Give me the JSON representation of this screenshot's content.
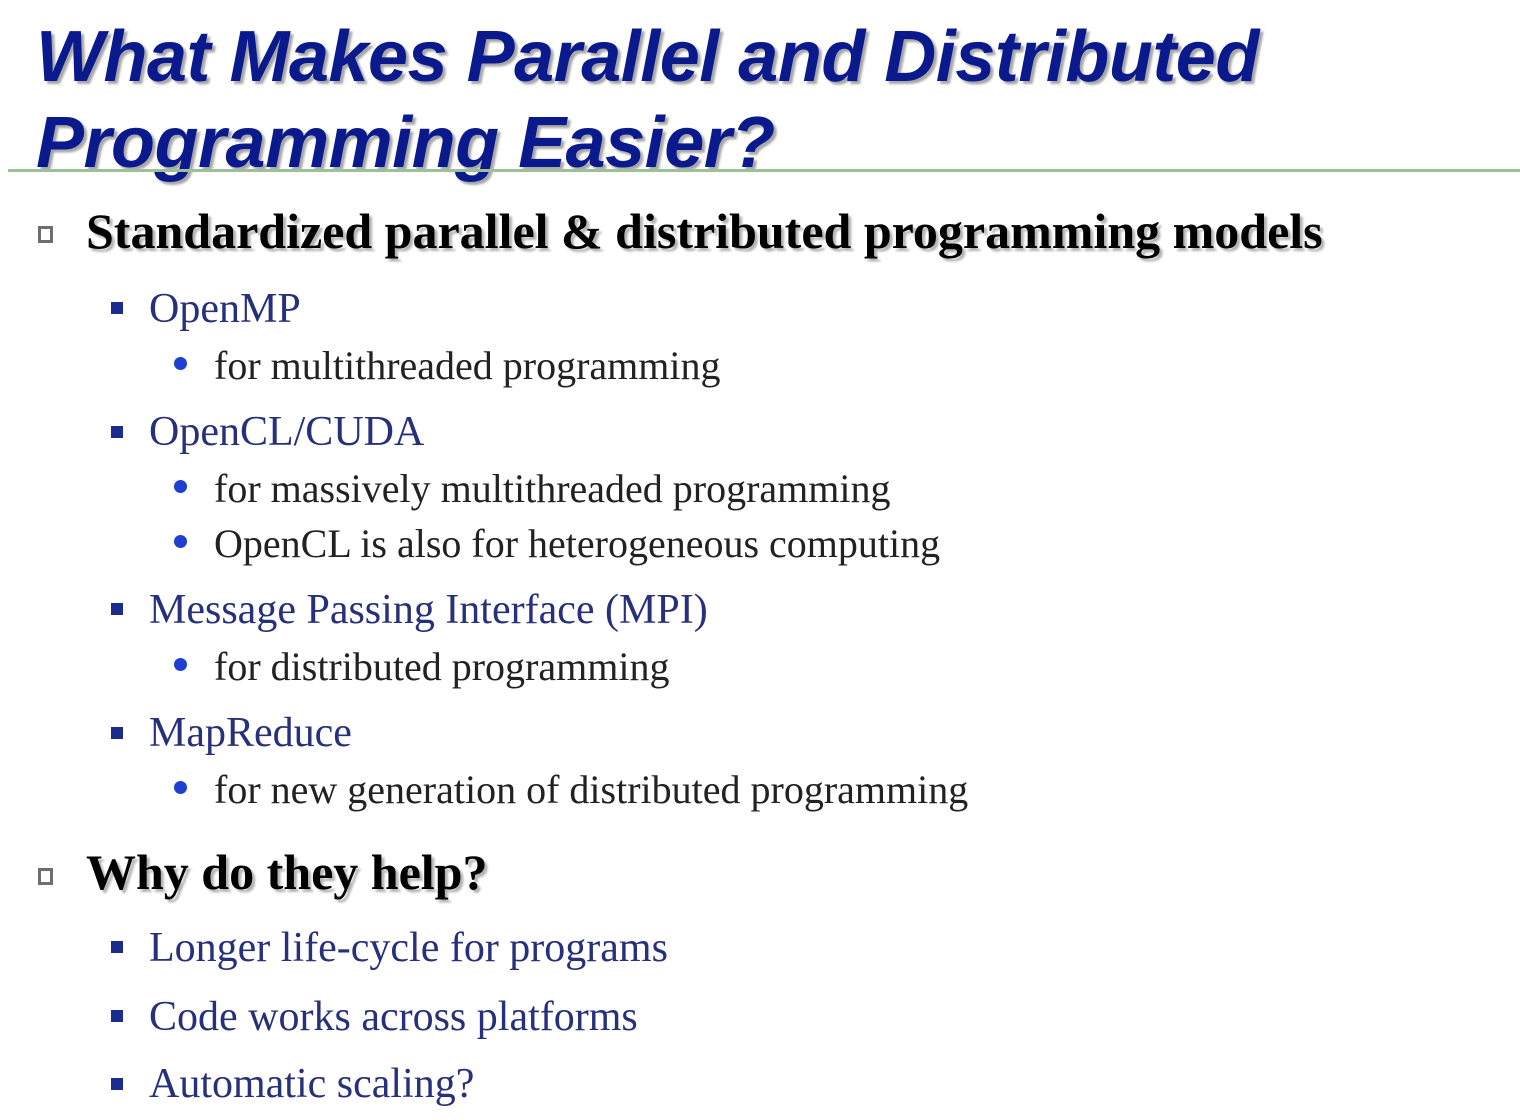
{
  "slide": {
    "title_line1": "What Makes Parallel and Distributed",
    "title_line2": "Programming Easier?",
    "section1": {
      "heading": "Standardized parallel & distributed programming models",
      "items": [
        {
          "label": "OpenMP",
          "subitems": [
            "for multithreaded programming"
          ]
        },
        {
          "label": "OpenCL/CUDA",
          "subitems": [
            "for massively multithreaded programming",
            "OpenCL is also for heterogeneous computing"
          ]
        },
        {
          "label": "Message Passing Interface (MPI)",
          "subitems": [
            "for distributed programming"
          ]
        },
        {
          "label": "MapReduce",
          "subitems": [
            "for new generation of distributed programming"
          ]
        }
      ]
    },
    "section2": {
      "heading": "Why do they help?",
      "items": [
        {
          "label": "Longer life-cycle for programs"
        },
        {
          "label": "Code works across platforms"
        },
        {
          "label": "Automatic scaling?"
        }
      ]
    },
    "colors": {
      "title": "#0a1a8c",
      "rule": "#9cc09a",
      "level2_text": "#27307a",
      "level2_bullet": "#1a2d8f",
      "level3_bullet": "#1f3fd1"
    },
    "bullet_icons": {
      "level1": "hollow-square-icon",
      "level2": "filled-square-icon",
      "level3": "filled-circle-icon"
    }
  }
}
